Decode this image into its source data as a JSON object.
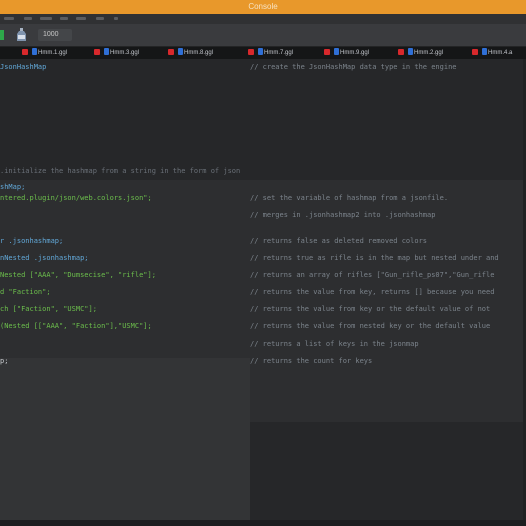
{
  "window": {
    "title": "Console"
  },
  "toolbar": {
    "field_value": "1000"
  },
  "tabs": [
    {
      "label": "Hmm.1.ggl"
    },
    {
      "label": "Hmm.3.ggl"
    },
    {
      "label": "Hmm.8.ggl"
    },
    {
      "label": "Hmm.7.ggl"
    },
    {
      "label": "Hmm.9.ggl"
    },
    {
      "label": "Hmm.2.ggl"
    },
    {
      "label": "Hmm.4.a"
    }
  ],
  "colors": {
    "title_bar": "#e8982b",
    "tab_close": "#d8282c",
    "tab_icon": "#2f6fd6",
    "keyword_blue": "#62a8d8",
    "string_green": "#6cbf4c",
    "comment_gray": "#7c848c"
  },
  "code": {
    "line1": {
      "code": "JsonHashMap",
      "comment": "// create the JsonHashMap data type in the engine"
    },
    "line2": {
      "code": ".initialize the hashmap from a string in the form of json"
    },
    "line3": {
      "code": "shMap;"
    },
    "line4": {
      "code": "ntered.plugin/json/web.colors.json\";",
      "comment": "// set the variable of hashmap from a jsonfile."
    },
    "line5": {
      "comment": "// merges in .jsonhashmap2 into .jsonhashmap"
    },
    "line6": {
      "code": "r .jsonhashmap;",
      "comment": "// returns false as deleted removed colors"
    },
    "line7": {
      "code": "nNested .jsonhashmap;",
      "comment": "// returns true as rifle is in the map but nested under and"
    },
    "line8": {
      "code": "Nested [\"AAA\", \"Dumsecise\", \"rifle\"];",
      "comment": "// returns an array of rifles [\"Gun_rifle_ps07\",\"Gun_rifle"
    },
    "line9": {
      "code": "d \"Faction\";",
      "comment": "// returns the value from key, returns [] because you need"
    },
    "line10": {
      "code": "ch [\"Faction\", \"USMC\"];",
      "comment": "// returns the value from key or the default value of not"
    },
    "line11": {
      "code": "(Nested [[\"AAA\", \"Faction\"],\"USMC\"];",
      "comment": "// returns the value from nested key or the default value"
    },
    "line12": {
      "comment": "// returns a list of keys in the jsonmap"
    },
    "line13": {
      "code": "p;",
      "comment": "// returns the count for keys"
    }
  }
}
